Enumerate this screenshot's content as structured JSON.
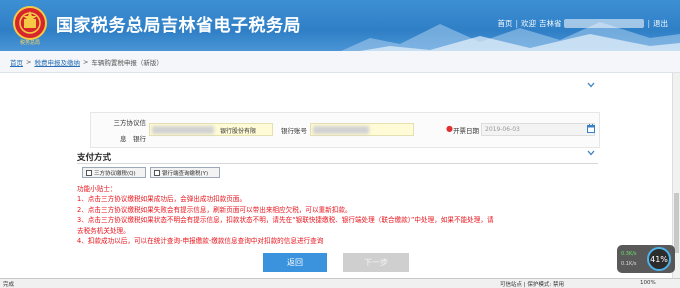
{
  "header": {
    "emblem_text": "税务总局",
    "title": "国家税务总局吉林省电子税务局",
    "nav_home": "首页",
    "nav_welcome": "欢迎",
    "nav_user": "吉林省",
    "nav_sep": "|",
    "nav_logout": "退出"
  },
  "breadcrumb": {
    "items": [
      "首页",
      "税费申报及缴纳",
      "车辆购置税申报（新版）"
    ],
    "sep": ">"
  },
  "form": {
    "label_bank_a": "三方协议信",
    "label_bank_b": "息　银行",
    "bank_value_suffix": "银行股份有限",
    "label_account": "银行账号",
    "required_mark": "●",
    "label_date": "开票日期",
    "date_value": "2019-06-03"
  },
  "payment": {
    "title": "支付方式",
    "option1": "三方协议缴税(Q)",
    "option2": "银行端查询缴税(Y)"
  },
  "tips": {
    "title": "功能小贴士：",
    "lines": [
      "1、点击三方协议缴税如果成功后，会弹出成功扣款页面。",
      "2、点击三方协议缴税如果失败会有提示信息，刷新页面可以带出来相应欠税，可以重新扣款。",
      "3、点击三方协议缴税如果状态不明会有提示信息，扣款状态不明，请先在“银联快捷缴税、银行端处理（联合缴款）”中处理，如果不能处理，请",
      "去税务机关处理。",
      "4、扣款成功以后，可以在统计查询-申报缴款-缴款信息查询中对扣款的信息进行查询"
    ]
  },
  "buttons": {
    "back": "返回",
    "next": "下一步"
  },
  "speed_widget": {
    "up": "0.3K/s",
    "down": "0.1K/s",
    "percent": "41%"
  },
  "statusbar": {
    "done": "完成",
    "trusted": "可信站点 | 保护模式: 禁用",
    "zoom": "100%"
  },
  "colors": {
    "header_blue": "#2f7fc6",
    "tip_red": "#e8141c",
    "primary_button": "#3b93dd",
    "disabled_button": "#cfcfcf"
  }
}
